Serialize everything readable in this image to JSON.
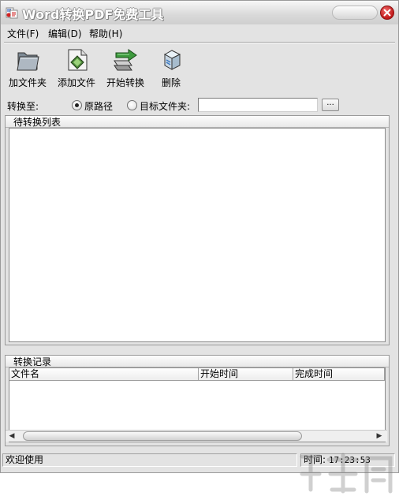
{
  "window": {
    "title": "Word转换PDF免费工具"
  },
  "menu": {
    "items": [
      "文件(F)",
      "编辑(D)",
      "帮助(H)"
    ]
  },
  "toolbar": {
    "add_folder_label": "加文件夹",
    "add_file_label": "添加文件",
    "start_convert_label": "开始转换",
    "delete_label": "删除"
  },
  "convert_to": {
    "label": "转换至:",
    "option_original": "原路径",
    "option_target": "目标文件夹:",
    "selected": "原路径",
    "target_value": "",
    "browse_label": "..."
  },
  "pending_list": {
    "title": "待转换列表",
    "items": []
  },
  "records": {
    "title": "转换记录",
    "columns": [
      "文件名",
      "开始时间",
      "完成时间"
    ],
    "rows": []
  },
  "status": {
    "message": "欢迎使用",
    "time_label": "时间:",
    "time_value": "17:23:53"
  },
  "colors": {
    "window_bg": "#e3e3e3",
    "close_button": "#d42020",
    "list_bg": "#ffffff"
  }
}
